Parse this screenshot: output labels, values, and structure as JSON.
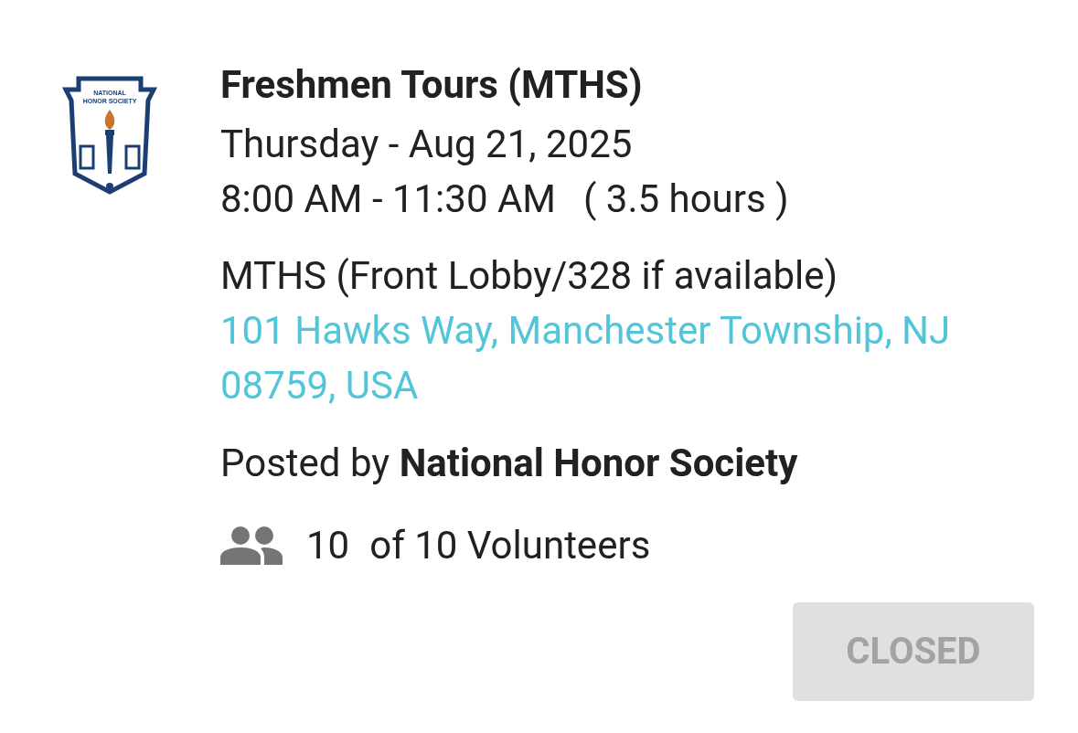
{
  "logo": {
    "lines": [
      "NATIONAL",
      "HONOR SOCIETY"
    ]
  },
  "event": {
    "title": "Freshmen Tours (MTHS)",
    "date": "Thursday - Aug 21, 2025",
    "time": "8:00 AM - 11:30 AM",
    "duration": "( 3.5 hours )",
    "location": "MTHS (Front Lobby/328 if available)",
    "address": "101 Hawks Way, Manchester Township, NJ 08759, USA",
    "posted_by": "Posted by **National Honor Society**",
    "volunteer_count": "10",
    "volunteer_total": "of 10 Volunteers"
  },
  "button": {
    "label": "CLOSED",
    "disabled": true
  }
}
